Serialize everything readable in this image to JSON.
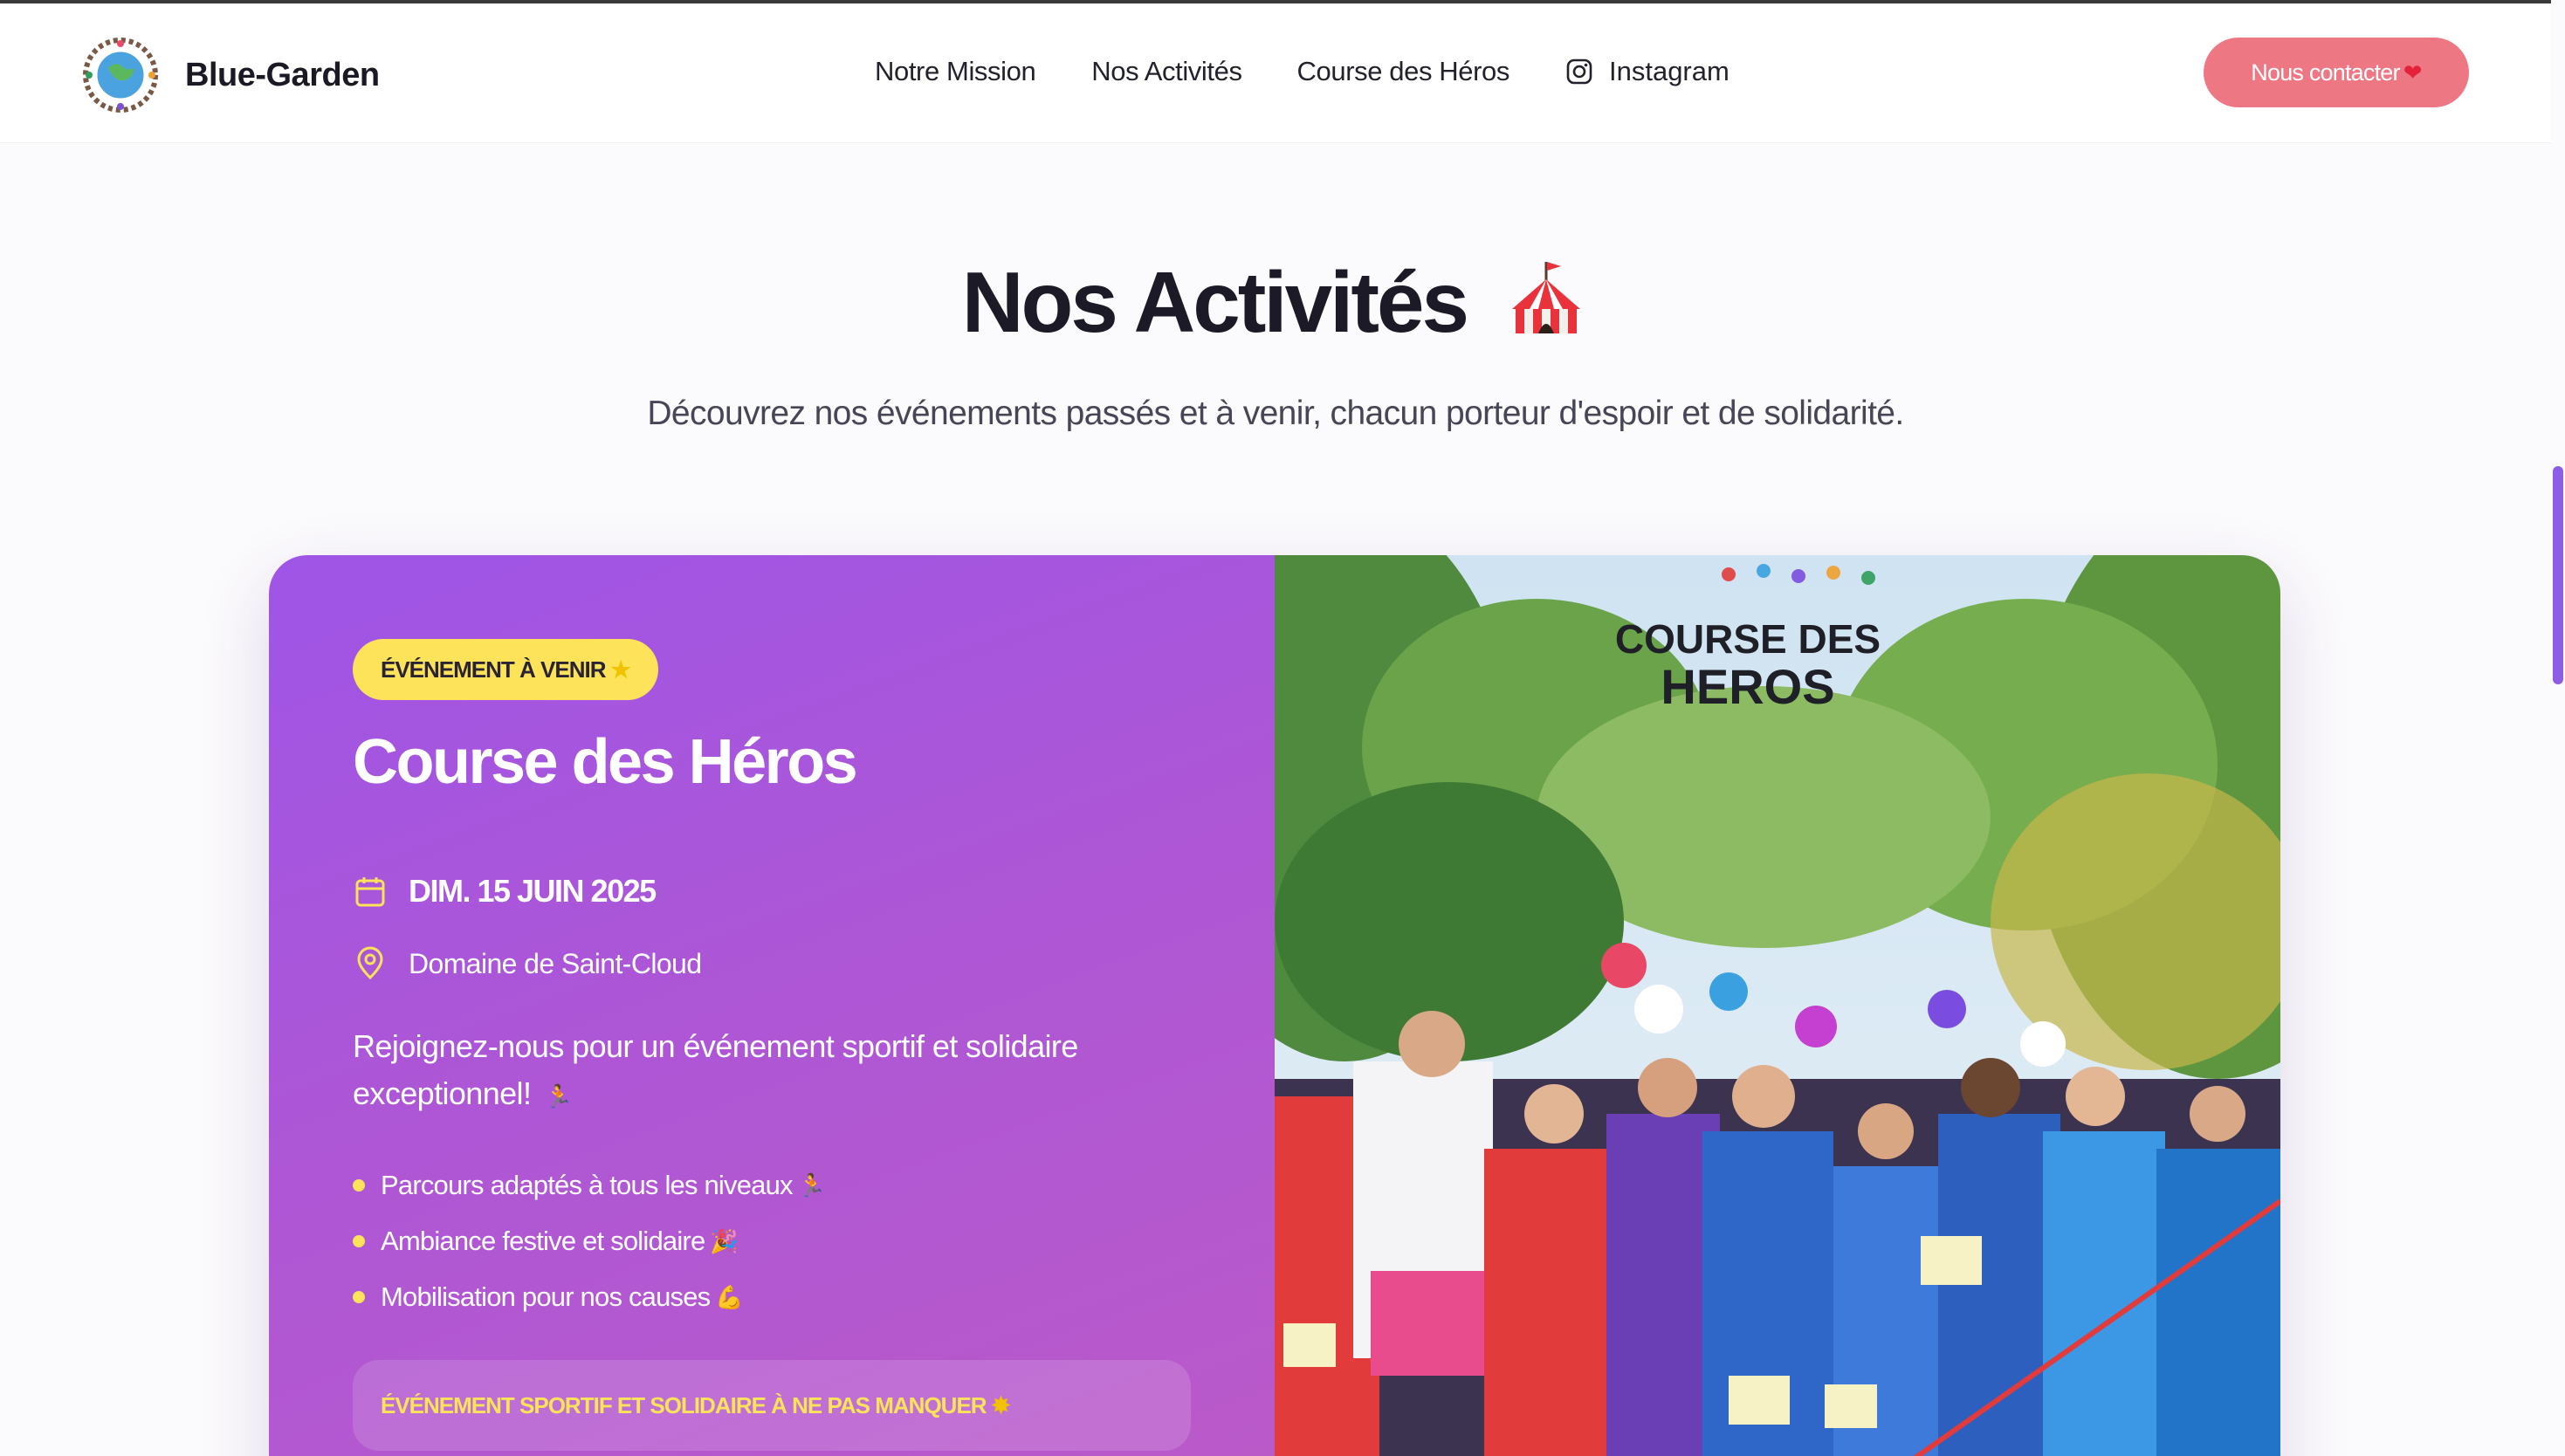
{
  "nav": {
    "brand_name": "Blue-Garden",
    "links": [
      "Notre Mission",
      "Nos Activités",
      "Course des Héros"
    ],
    "instagram_label": "Instagram",
    "cta_label": "Nous contacter",
    "cta_icon": "heart-icon"
  },
  "section": {
    "title": "Nos Activités",
    "title_icon": "circus-tent-icon",
    "subtitle": "Découvrez nos événements passés et à venir, chacun porteur d'espoir et de solidarité."
  },
  "event": {
    "badge": "ÉVÉNEMENT À VENIR",
    "badge_icon": "star-icon",
    "title": "Course des Héros",
    "date": "DIM. 15 JUIN 2025",
    "location": "Domaine de Saint-Cloud",
    "description": "Rejoignez-nous pour un événement sportif et solidaire exceptionnel!",
    "features": [
      {
        "text": "Parcours adaptés à tous les niveaux",
        "icon": "runner-icon"
      },
      {
        "text": "Ambiance festive et solidaire",
        "icon": "party-popper-icon"
      },
      {
        "text": "Mobilisation pour nos causes",
        "icon": "flexed-biceps-icon"
      }
    ],
    "callout": "ÉVÉNEMENT SPORTIF ET SOLIDAIRE À NE PAS MANQUER",
    "callout_icon": "sparkle-icon",
    "photo_caption": "COURSE DES HEROS"
  },
  "colors": {
    "accent": "#ee7784",
    "card_purple": "#a855e0",
    "badge_yellow": "#fde359",
    "scroll_thumb": "#8d5de6"
  }
}
